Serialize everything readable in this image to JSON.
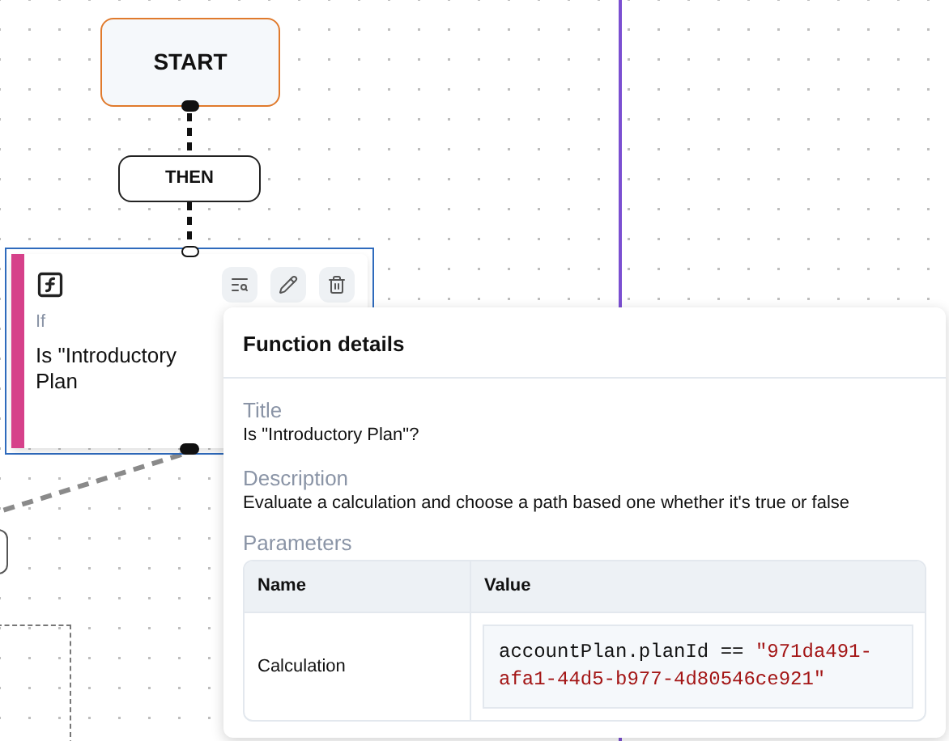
{
  "canvas": {
    "nodes": [
      {
        "kind": "start",
        "label": "START",
        "selected": false
      },
      {
        "kind": "then",
        "label": "THEN",
        "selected": false
      },
      {
        "kind": "function",
        "label": "If",
        "text": "Is \"Introductory Plan",
        "selected": true
      }
    ]
  },
  "popover": {
    "title": "Function details",
    "sections": [
      {
        "label": "Title",
        "text": "Is \"Introductory Plan\"?"
      },
      {
        "label": "Description",
        "text": "Evaluate a calculation and choose a path based one whether it's true or false"
      }
    ],
    "parameters": {
      "label": "Parameters",
      "columns": [
        "Name",
        "Value"
      ],
      "rows": [
        {
          "name": "Calculation",
          "expression": "accountPlan.planId ==",
          "literal": "\"971da491-afa1-44d5-b977-4d80546ce921\""
        }
      ]
    }
  }
}
